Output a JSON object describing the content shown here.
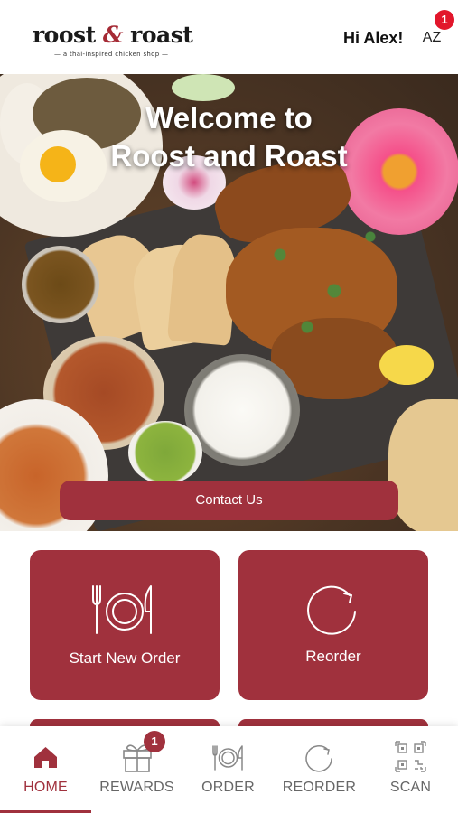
{
  "header": {
    "logo_text_left": "roost",
    "logo_amp": "&",
    "logo_text_right": "roast",
    "logo_tagline": "— a thai-inspired chicken shop —",
    "greeting": "Hi Alex!",
    "avatar_initials": "AZ",
    "notification_count": "1"
  },
  "hero": {
    "title_line1": "Welcome to",
    "title_line2": "Roost and Roast",
    "contact_button": "Contact Us"
  },
  "tiles": [
    {
      "label": "Start New Order",
      "icon": "cutlery-plate-icon"
    },
    {
      "label": "Reorder",
      "icon": "refresh-arrow-icon"
    }
  ],
  "nav": {
    "items": [
      {
        "label": "HOME",
        "icon": "home-icon",
        "active": true
      },
      {
        "label": "REWARDS",
        "icon": "gift-icon",
        "badge": "1"
      },
      {
        "label": "ORDER",
        "icon": "cutlery-plate-icon"
      },
      {
        "label": "REORDER",
        "icon": "refresh-arrow-icon"
      },
      {
        "label": "SCAN",
        "icon": "qr-code-icon"
      }
    ]
  },
  "colors": {
    "brand": "#a0313d",
    "badge_red": "#e2162b"
  }
}
